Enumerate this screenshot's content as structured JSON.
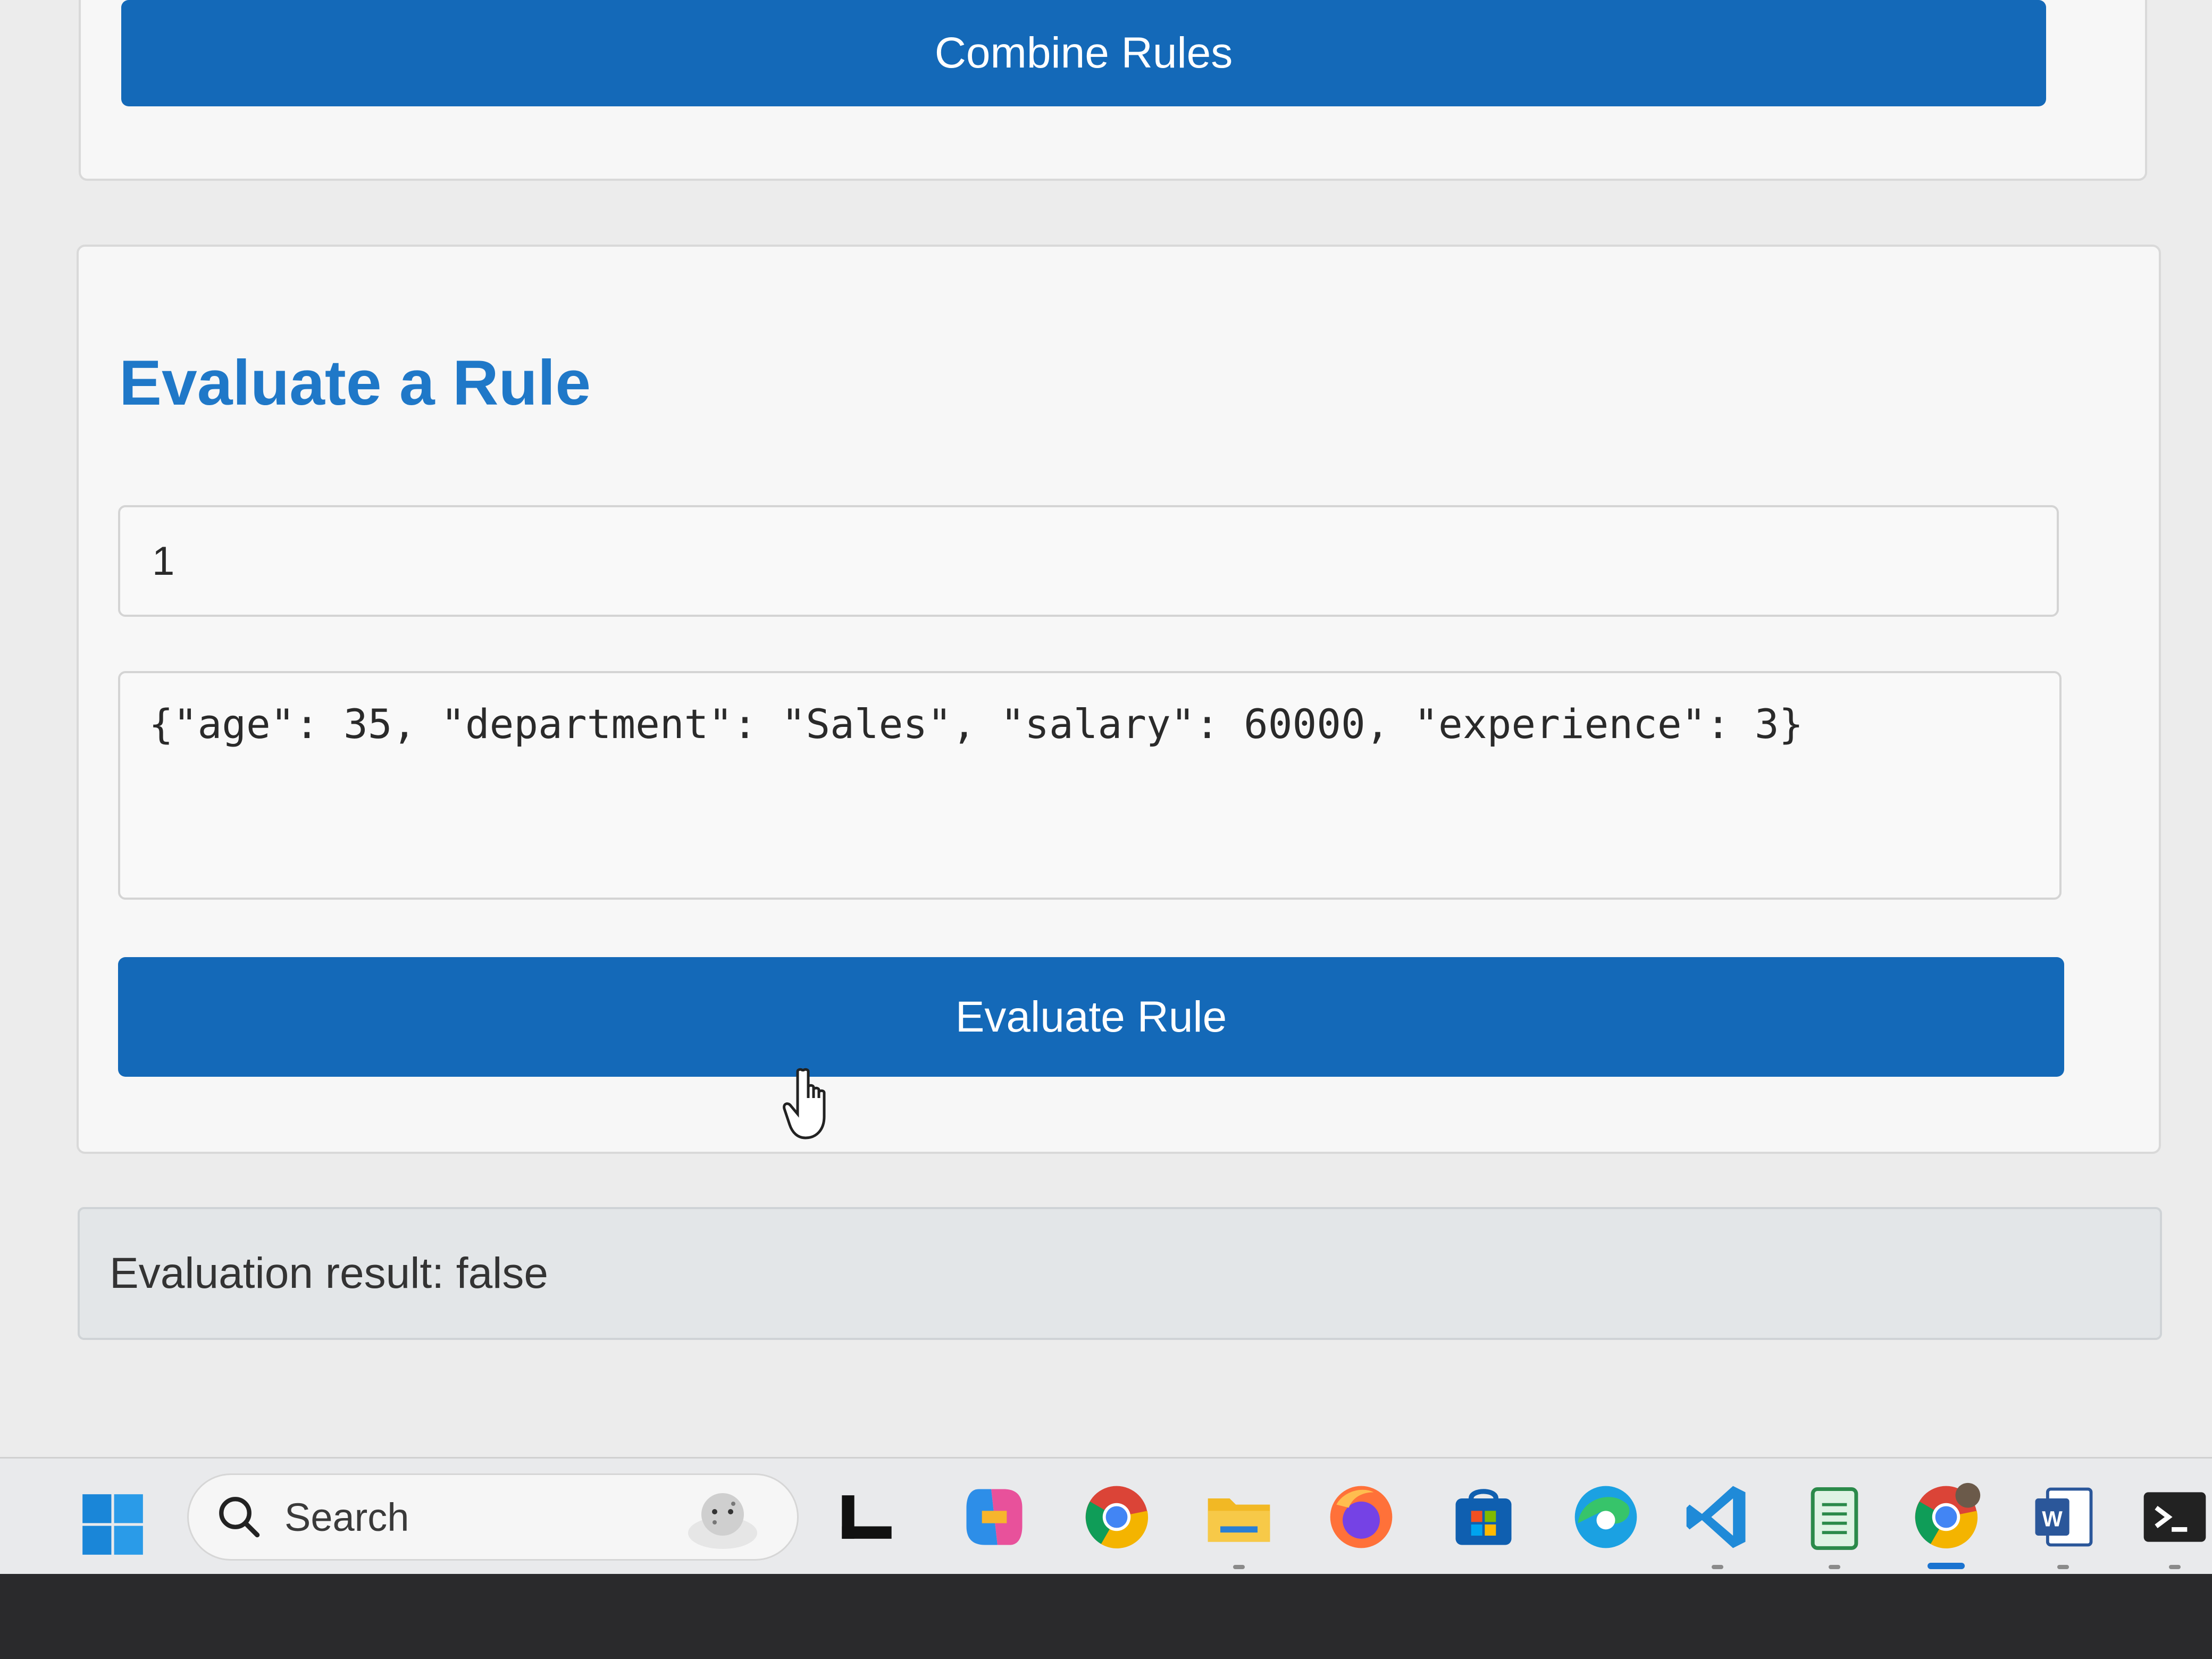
{
  "combine_section": {
    "button_label": "Combine Rules"
  },
  "evaluate_section": {
    "title": "Evaluate a Rule",
    "rule_input_value": "1",
    "data_textarea_value": "{\"age\": 35, \"department\": \"Sales\", \"salary\": 60000, \"experience\": 3}",
    "button_label": "Evaluate Rule"
  },
  "result": {
    "text": "Evaluation result: false"
  },
  "taskbar": {
    "search_label": "Search",
    "icons": [
      "windows-start-icon",
      "search-icon",
      "snow-leopard-widget-icon",
      "task-view-icon",
      "copilot-icon",
      "chrome-icon",
      "file-explorer-icon",
      "firefox-icon",
      "microsoft-store-icon",
      "edge-icon",
      "vscode-icon",
      "notepad-icon",
      "chrome-profile-icon",
      "word-icon",
      "terminal-icon"
    ]
  },
  "colors": {
    "accent": "#1469b8",
    "heading": "#1f78c8",
    "result_bg": "#e3e6e8"
  }
}
